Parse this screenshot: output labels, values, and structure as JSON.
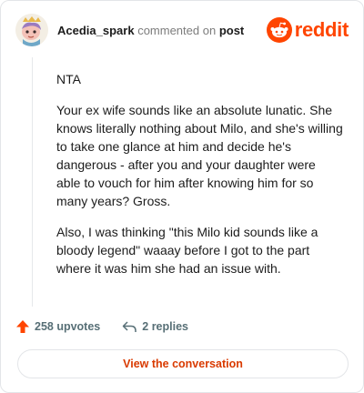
{
  "header": {
    "author": "Acedia_spark",
    "action_text": "commented on",
    "post_label": "post",
    "brand": "reddit"
  },
  "comment": {
    "paragraphs": [
      "NTA",
      "Your ex wife sounds like an absolute lunatic. She knows literally nothing about Milo, and she's willing to take one glance at him and decide he's dangerous - after you and your daughter were able to vouch for him after knowing him for so many years? Gross.",
      "Also, I was thinking \"this Milo kid sounds like a bloody legend\" waaay before I got to the part where it was him she had an issue with."
    ]
  },
  "actions": {
    "upvotes": "258 upvotes",
    "replies": "2 replies"
  },
  "footer": {
    "view_button": "View the conversation"
  },
  "colors": {
    "brand": "#ff4500",
    "upvote": "#ff4500",
    "link_button_text": "#d93a00"
  },
  "icons": {
    "avatar": "avatar-icon",
    "brand": "reddit-snoo-icon",
    "upvote": "upvote-arrow-icon",
    "reply": "reply-arrow-icon"
  }
}
